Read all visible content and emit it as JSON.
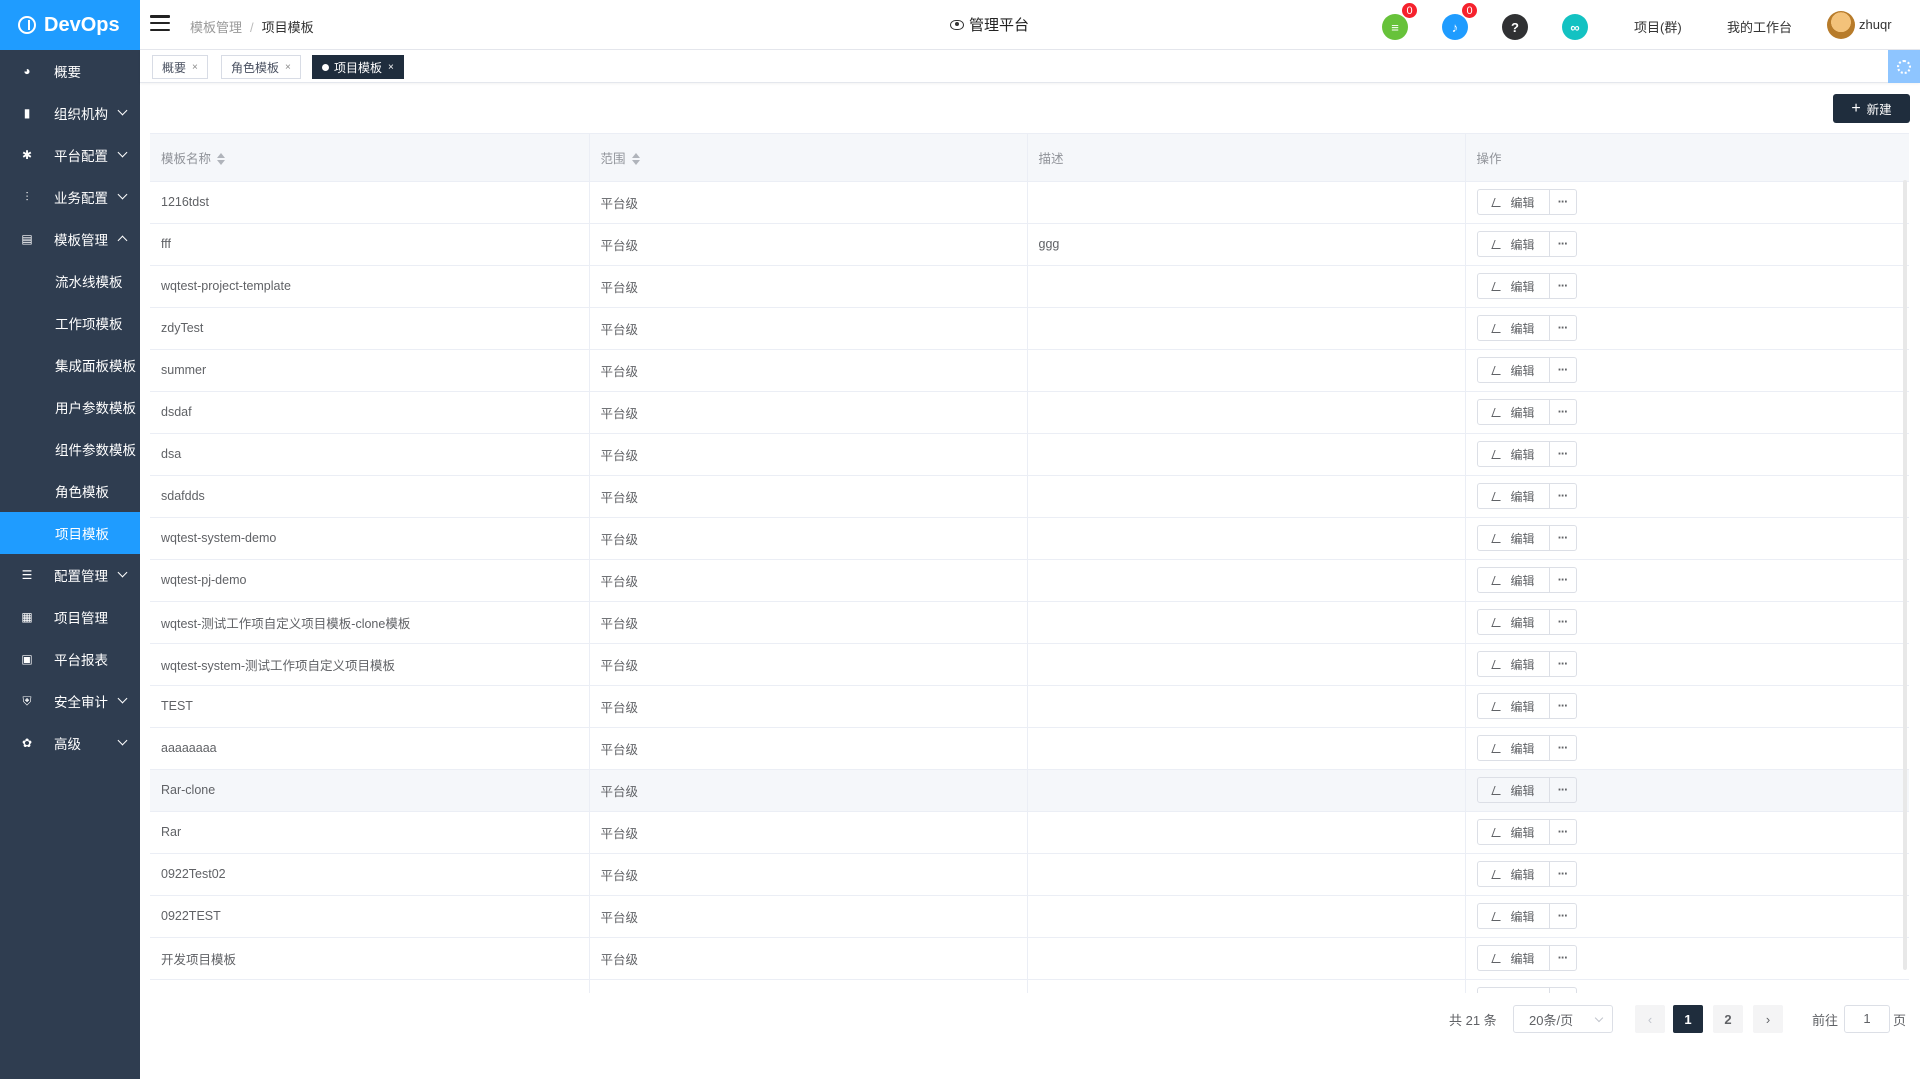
{
  "app": {
    "logo_text": "DevOps"
  },
  "sidebar": {
    "items": [
      {
        "label": "概要",
        "icon": "dashboard-icon",
        "glyph": "◕",
        "expandable": false
      },
      {
        "label": "组织机构",
        "icon": "lock-icon",
        "glyph": "▮",
        "expandable": true
      },
      {
        "label": "平台配置",
        "icon": "gear-icon",
        "glyph": "✱",
        "expandable": true
      },
      {
        "label": "业务配置",
        "icon": "sliders-icon",
        "glyph": "⫶",
        "expandable": true
      },
      {
        "label": "模板管理",
        "icon": "template-icon",
        "glyph": "▤",
        "expandable": true,
        "expanded": true
      }
    ],
    "sub_items": [
      "流水线模板",
      "工作项模板",
      "集成面板模板",
      "用户参数模板",
      "组件参数模板",
      "角色模板",
      "项目模板"
    ],
    "active_sub": "项目模板",
    "items_after": [
      {
        "label": "配置管理",
        "icon": "database-icon",
        "glyph": "☰",
        "expandable": true
      },
      {
        "label": "项目管理",
        "icon": "grid-icon",
        "glyph": "▦",
        "expandable": false
      },
      {
        "label": "平台报表",
        "icon": "monitor-icon",
        "glyph": "▣",
        "expandable": false
      },
      {
        "label": "安全审计",
        "icon": "shield-icon",
        "glyph": "⛨",
        "expandable": true
      },
      {
        "label": "高级",
        "icon": "palette-icon",
        "glyph": "✿",
        "expandable": true
      }
    ]
  },
  "header": {
    "breadcrumb": [
      "模板管理",
      "项目模板"
    ],
    "center_title": "管理平台",
    "doc_badge": "0",
    "bell_badge": "0",
    "help_glyph": "?",
    "project_link": "项目(群)",
    "workbench_link": "我的工作台",
    "username": "zhuqr",
    "colors": {
      "doc": "#67c23a",
      "bell": "#1f9cff",
      "help": "#303133",
      "link": "#13c2c2"
    }
  },
  "tabs": [
    {
      "label": "概要",
      "active": false
    },
    {
      "label": "角色模板",
      "active": false
    },
    {
      "label": "项目模板",
      "active": true
    }
  ],
  "toolbar": {
    "new_label": "新建"
  },
  "table": {
    "columns": [
      "模板名称",
      "范围",
      "描述",
      "操作"
    ],
    "edit_label": "编辑",
    "more_label": "···",
    "rows": [
      {
        "name": "1216tdst",
        "scope": "平台级",
        "desc": ""
      },
      {
        "name": "fff",
        "scope": "平台级",
        "desc": "ggg"
      },
      {
        "name": "wqtest-project-template",
        "scope": "平台级",
        "desc": ""
      },
      {
        "name": "zdyTest",
        "scope": "平台级",
        "desc": ""
      },
      {
        "name": "summer",
        "scope": "平台级",
        "desc": ""
      },
      {
        "name": "dsdaf",
        "scope": "平台级",
        "desc": ""
      },
      {
        "name": "dsa",
        "scope": "平台级",
        "desc": ""
      },
      {
        "name": "sdafdds",
        "scope": "平台级",
        "desc": ""
      },
      {
        "name": "wqtest-system-demo",
        "scope": "平台级",
        "desc": ""
      },
      {
        "name": "wqtest-pj-demo",
        "scope": "平台级",
        "desc": ""
      },
      {
        "name": "wqtest-测试工作项自定义项目模板-clone模板",
        "scope": "平台级",
        "desc": ""
      },
      {
        "name": "wqtest-system-测试工作项自定义项目模板",
        "scope": "平台级",
        "desc": ""
      },
      {
        "name": "TEST",
        "scope": "平台级",
        "desc": ""
      },
      {
        "name": "aaaaaaaa",
        "scope": "平台级",
        "desc": ""
      },
      {
        "name": "Rar-clone",
        "scope": "平台级",
        "desc": ""
      },
      {
        "name": "Rar",
        "scope": "平台级",
        "desc": ""
      },
      {
        "name": "0922Test02",
        "scope": "平台级",
        "desc": ""
      },
      {
        "name": "0922TEST",
        "scope": "平台级",
        "desc": ""
      },
      {
        "name": "开发项目模板",
        "scope": "平台级",
        "desc": ""
      },
      {
        "name": "",
        "scope": "",
        "desc": ""
      }
    ],
    "hover_row": 14
  },
  "pagination": {
    "total_text": "共 21 条",
    "page_size": "20条/页",
    "pages": [
      "1",
      "2"
    ],
    "current": "1",
    "goto_label": "前往",
    "goto_value": "1",
    "page_suffix": "页"
  }
}
